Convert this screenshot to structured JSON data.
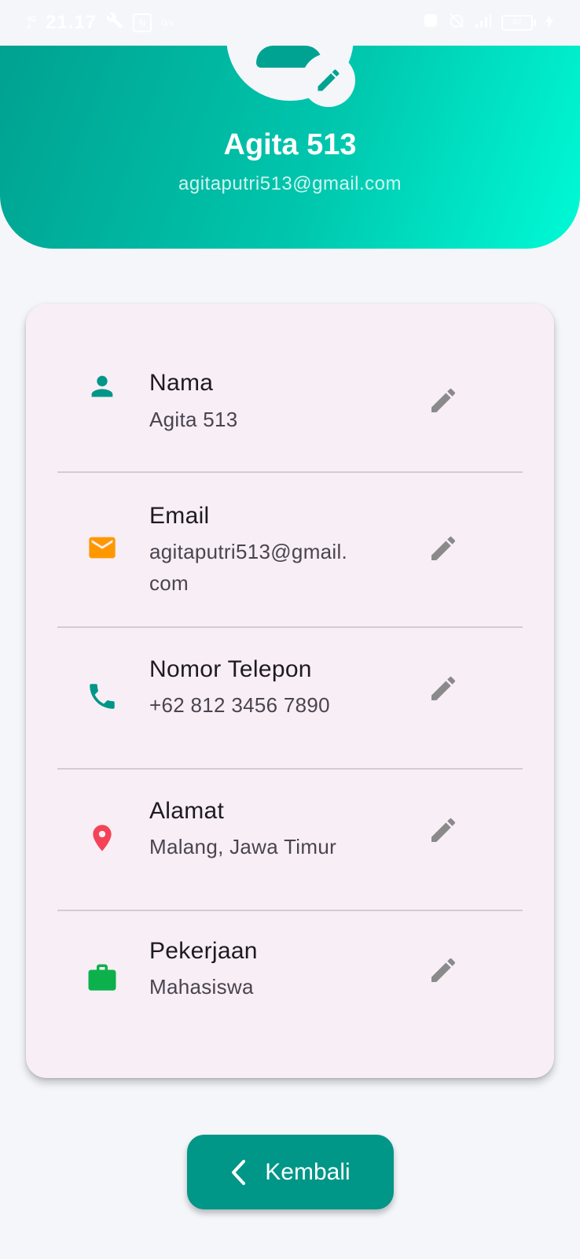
{
  "status_bar": {
    "network_top": "4G",
    "network_bottom": "ıl",
    "time": "21.17",
    "nfc_label": "N",
    "signal_speed": "0/s",
    "battery_level": "82"
  },
  "profile": {
    "name": "Agita 513",
    "email": "agitaputri513@gmail.com"
  },
  "fields": [
    {
      "label": "Nama",
      "value": "Agita 513",
      "icon": "person-icon",
      "icon_color": "#009688"
    },
    {
      "label": "Email",
      "value": "agitaputri513@gmail.\ncom",
      "icon": "email-icon",
      "icon_color": "#ff9800"
    },
    {
      "label": "Nomor Telepon",
      "value": "+62 812 3456 7890",
      "icon": "phone-icon",
      "icon_color": "#009688"
    },
    {
      "label": "Alamat",
      "value": "Malang, Jawa Timur",
      "icon": "location-pin-icon",
      "icon_color": "#f44357"
    },
    {
      "label": "Pekerjaan",
      "value": "Mahasiswa",
      "icon": "briefcase-icon",
      "icon_color": "#0cb14b"
    }
  ],
  "back_button": {
    "label": "Kembali"
  },
  "colors": {
    "accent": "#009688",
    "header_gradient_start": "#00a190",
    "header_gradient_end": "#00fad6",
    "card_background": "#f8eef6",
    "edit_icon": "#8a8a8a"
  }
}
